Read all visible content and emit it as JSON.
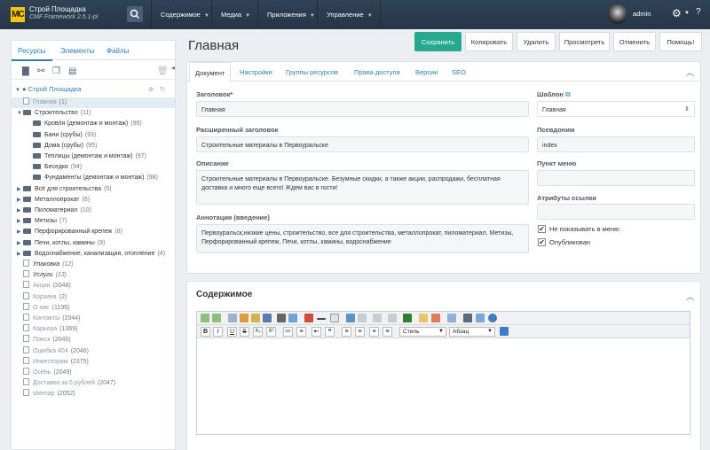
{
  "header": {
    "logo_text": "MC",
    "site_name": "Строй Площадка",
    "version": "CMF Framework 2.5.1-pl",
    "nav": [
      {
        "label": "Содержимое"
      },
      {
        "label": "Медиа"
      },
      {
        "label": "Приложения"
      },
      {
        "label": "Управление"
      }
    ],
    "user": "admin"
  },
  "sidebar": {
    "tabs": [
      "Ресурсы",
      "Элементы",
      "Файлы"
    ],
    "active_tab": "Ресурсы",
    "context": "Строй Площадка",
    "tree": [
      {
        "label": "Главная",
        "count": "(1)",
        "type": "doc",
        "level": 0,
        "style": "grey",
        "selected": true
      },
      {
        "label": "Строительство",
        "count": "(11)",
        "type": "folder-open",
        "level": 0,
        "style": "dark"
      },
      {
        "label": "Кровля (демонтаж и монтаж)",
        "count": "(96)",
        "type": "folder",
        "level": 1,
        "style": "dark"
      },
      {
        "label": "Бани (срубы)",
        "count": "(93)",
        "type": "folder",
        "level": 1,
        "style": "dark"
      },
      {
        "label": "Дома (срубы)",
        "count": "(95)",
        "type": "folder",
        "level": 1,
        "style": "dark"
      },
      {
        "label": "Теплицы (демонтаж и монтаж)",
        "count": "(97)",
        "type": "folder",
        "level": 1,
        "style": "dark"
      },
      {
        "label": "Беседки",
        "count": "(94)",
        "type": "folder",
        "level": 1,
        "style": "dark"
      },
      {
        "label": "Фундаменты (демонтаж и монтаж)",
        "count": "(98)",
        "type": "folder",
        "level": 1,
        "style": "dark"
      },
      {
        "label": "Всё для строительства",
        "count": "(5)",
        "type": "folder",
        "level": 0,
        "style": "dark",
        "arrow": true
      },
      {
        "label": "Металлопрокат",
        "count": "(6)",
        "type": "folder",
        "level": 0,
        "style": "dark",
        "arrow": true
      },
      {
        "label": "Пиломатериал",
        "count": "(10)",
        "type": "folder",
        "level": 0,
        "style": "dark",
        "arrow": true
      },
      {
        "label": "Метизы",
        "count": "(7)",
        "type": "folder",
        "level": 0,
        "style": "dark",
        "arrow": true
      },
      {
        "label": "Перфорированный крепеж",
        "count": "(8)",
        "type": "folder",
        "level": 0,
        "style": "dark",
        "arrow": true
      },
      {
        "label": "Печи, котлы, камины",
        "count": "(9)",
        "type": "folder",
        "level": 0,
        "style": "dark",
        "arrow": true
      },
      {
        "label": "Водоснабжение, канализация, отопление",
        "count": "(4)",
        "type": "folder",
        "level": 0,
        "style": "dark",
        "arrow": true
      },
      {
        "label": "Упаковка",
        "count": "(12)",
        "type": "doc",
        "level": 0,
        "style": "ital"
      },
      {
        "label": "Услуги",
        "count": "(13)",
        "type": "doc",
        "level": 0,
        "style": "ital"
      },
      {
        "label": "Акции",
        "count": "(2048)",
        "type": "doc",
        "level": 0,
        "style": "grey"
      },
      {
        "label": "Корзина",
        "count": "(2)",
        "type": "doc",
        "level": 0,
        "style": "grey"
      },
      {
        "label": "О нас",
        "count": "(1195)",
        "type": "doc",
        "level": 0,
        "style": "grey"
      },
      {
        "label": "Контакты",
        "count": "(2044)",
        "type": "doc",
        "level": 0,
        "style": "grey"
      },
      {
        "label": "Карьера",
        "count": "(1369)",
        "type": "doc",
        "level": 0,
        "style": "grey"
      },
      {
        "label": "Поиск",
        "count": "(2045)",
        "type": "doc",
        "level": 0,
        "style": "grey"
      },
      {
        "label": "Ошибка 404",
        "count": "(2046)",
        "type": "doc",
        "level": 0,
        "style": "grey"
      },
      {
        "label": "Инвесторам",
        "count": "(2375)",
        "type": "doc",
        "level": 0,
        "style": "grey"
      },
      {
        "label": "Осень",
        "count": "(2049)",
        "type": "doc",
        "level": 0,
        "style": "grey"
      },
      {
        "label": "Доставка за 5 рублей",
        "count": "(2047)",
        "type": "doc",
        "level": 0,
        "style": "grey"
      },
      {
        "label": "sitemap",
        "count": "(2052)",
        "type": "doc",
        "level": 0,
        "style": "grey"
      }
    ]
  },
  "page": {
    "title": "Главная",
    "buttons": [
      "Сохранить",
      "Копировать",
      "Удалить",
      "Просмотреть",
      "Отменить",
      "Помощь!"
    ]
  },
  "resource": {
    "tabs": [
      "Документ",
      "Настройки",
      "Группы ресурсов",
      "Права доступа",
      "Версии",
      "SEO"
    ],
    "active_tab": "Документ",
    "fields": {
      "pagetitle_label": "Заголовок*",
      "pagetitle": "Главная",
      "longtitle_label": "Расширенный заголовок",
      "longtitle": "Строительные материалы в Первоуральске",
      "description_label": "Описание",
      "description": "Строительные материалы в Первоуральске. Безумные скидки, а также акции, распродажи, бесплатная доставка и много еще всего! Ждем вас в гости!",
      "introtext_label": "Аннотация (введение)",
      "introtext": "Первоуральск,низкие цены, строительство, все для строительства, металлопрокат, пиломатериал, Метизы, Перфорированный крепеж, Печи, котлы, камины, водоснабжение",
      "template_label": "Шаблон",
      "template": "Главная",
      "alias_label": "Псевдоним",
      "alias": "index",
      "menutitle_label": "Пункт меню",
      "menutitle": "",
      "link_attrs_label": "Атрибуты ссылки",
      "link_attrs": "",
      "hidemenu_label": "Не показывать в меню",
      "hidemenu": true,
      "published_label": "Опубликован",
      "published": true
    }
  },
  "content": {
    "title": "Содержимое",
    "style_select": "Стиль",
    "format_select": "Абзац"
  },
  "colors": {
    "accent": "#2c7fb8",
    "primary_button": "#26a98f",
    "topbar": "#2f4256"
  }
}
